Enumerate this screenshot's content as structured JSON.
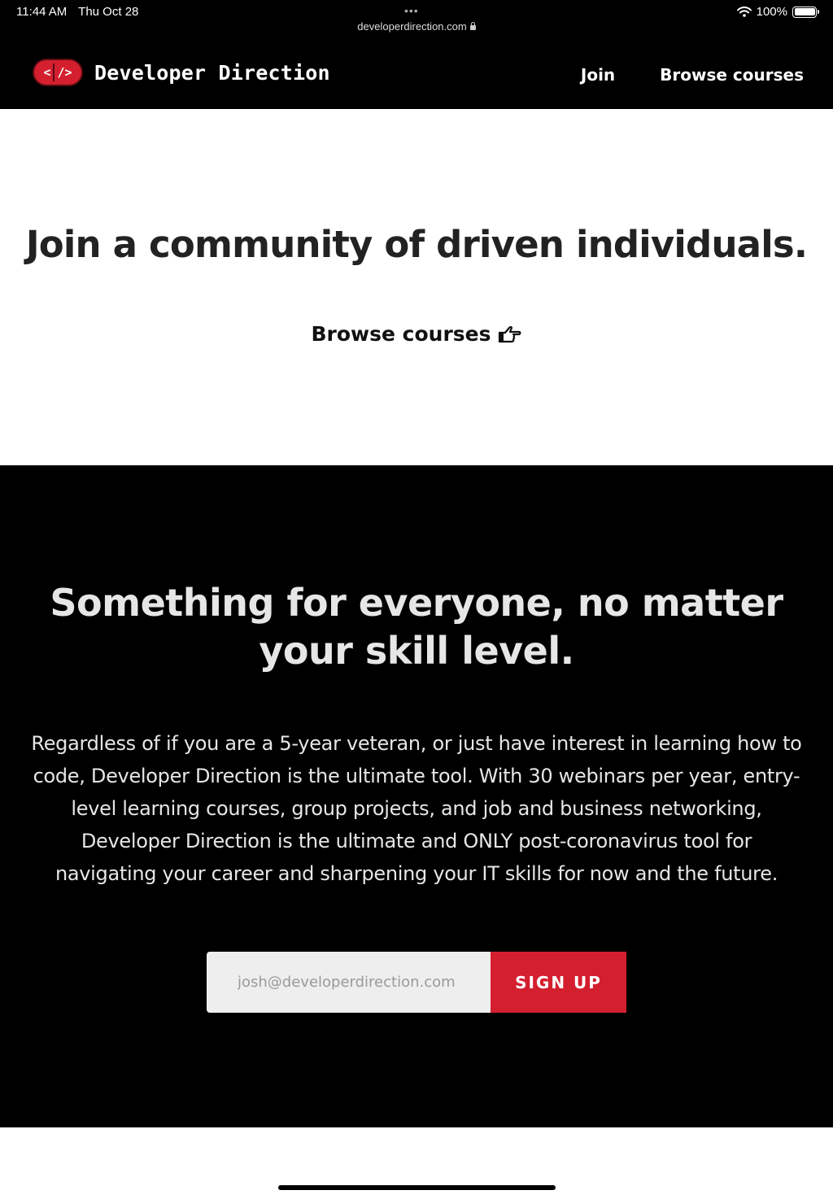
{
  "status_bar": {
    "time": "11:44 AM",
    "date": "Thu Oct 28",
    "dots": "•••",
    "url": "developerdirection.com",
    "battery": "100%"
  },
  "navbar": {
    "logo_text_left": "<",
    "logo_text_right": "/>",
    "brand": "Developer Direction",
    "links": [
      {
        "label": "Join"
      },
      {
        "label": "Browse courses"
      }
    ]
  },
  "hero": {
    "title": "Join a community of driven individuals.",
    "link_label": "Browse courses"
  },
  "features": {
    "title": "Something for everyone, no matter your skill level.",
    "body": "Regardless of if you are a 5-year veteran, or just have interest in learning how to code, Developer Direction is the ultimate tool. With 30 webinars per year, entry-level learning courses, group projects, and job and business networking, Developer Direction is the ultimate and ONLY post-coronavirus tool for navigating your career and sharpening your IT skills for now and the future."
  },
  "signup": {
    "email_placeholder": "josh@developerdirection.com",
    "email_value": "",
    "button_label": "SIGN UP"
  },
  "colors": {
    "accent": "#d41f2f",
    "dark_bg": "#000000",
    "light_bg": "#ffffff",
    "input_bg": "#eeeeee"
  },
  "icons": {
    "hero_link_icon": "pointing-hand-icon",
    "secure": "lock-icon",
    "wifi": "wifi-icon",
    "battery": "battery-icon"
  }
}
